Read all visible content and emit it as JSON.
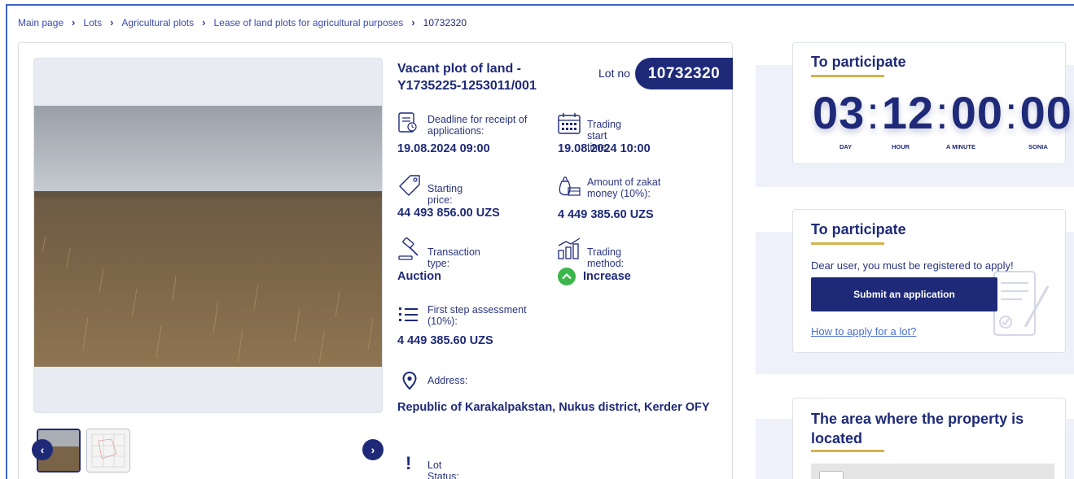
{
  "breadcrumb": {
    "items": [
      "Main page",
      "Lots",
      "Agricultural plots",
      "Lease of land plots for agricultural purposes"
    ],
    "current": "10732320"
  },
  "lot": {
    "title": "Vacant plot of land - Y1735225-1253011/001",
    "lot_no_label": "Lot no",
    "lot_no": "10732320"
  },
  "details": {
    "deadline_label": "Deadline for receipt of applications:",
    "deadline_value": "19.08.2024 09:00",
    "trading_start_label": "Trading start time:",
    "trading_start_value": "19.08.2024 10:00",
    "starting_price_label": "Starting price:",
    "starting_price_value": "44 493 856.00 UZS",
    "zakat_label": "Amount of zakat money (10%):",
    "zakat_value": "4 449 385.60 UZS",
    "transaction_type_label": "Transaction type:",
    "transaction_type_value": "Auction",
    "trading_method_label": "Trading method:",
    "trading_method_value": "Increase",
    "first_step_label": "First step assessment (10%):",
    "first_step_value": "4 449 385.60 UZS",
    "address_label": "Address:",
    "address_value": "Republic of Karakalpakstan, Nukus district, Kerder OFY",
    "status_label": "Lot Status:"
  },
  "countdown": {
    "title": "To participate",
    "days": "03",
    "hours": "12",
    "minutes": "00",
    "seconds": "00",
    "day_label": "DAY",
    "hour_label": "HOUR",
    "minute_label": "A MINUTE",
    "second_label": "SONIA"
  },
  "apply": {
    "title": "To participate",
    "message": "Dear user, you must be registered to apply!",
    "submit_label": "Submit an application",
    "howto_label": "How to apply for a lot?"
  },
  "area": {
    "title": "The area where the property is located"
  },
  "colors": {
    "primary": "#1e2a78",
    "accent_gold": "#d3b44a",
    "success_green": "#3cb54a",
    "link": "#4a6fd6",
    "panel_bg": "#eef1fa"
  }
}
